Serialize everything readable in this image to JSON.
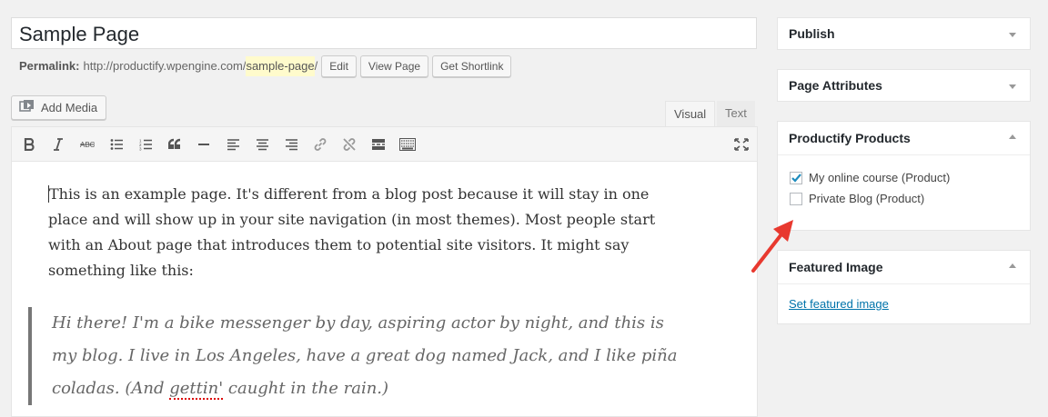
{
  "title": "Sample Page",
  "permalink": {
    "label": "Permalink:",
    "base": "http://productify.wpengine.com/",
    "slug": "sample-page",
    "trailing": "/",
    "buttons": [
      "Edit",
      "View Page",
      "Get Shortlink"
    ]
  },
  "add_media": "Add Media",
  "tabs": {
    "visual": "Visual",
    "text": "Text"
  },
  "toolbar_icons": [
    "bold-icon",
    "italic-icon",
    "strikethrough-icon",
    "bullet-list-icon",
    "numbered-list-icon",
    "blockquote-icon",
    "horizontal-line-icon",
    "align-left-icon",
    "align-center-icon",
    "align-right-icon",
    "link-icon",
    "unlink-icon",
    "read-more-icon",
    "toolbar-toggle-icon",
    "fullscreen-icon"
  ],
  "content": {
    "para1": "This is an example page. It's different from a blog post because it will stay in one place and will show up in your site navigation (in most themes). Most people start with an About page that introduces them to potential site visitors. It might say something like this:",
    "quote_part1": "Hi there! I'm a bike messenger by day, aspiring actor by night, and this is my blog. I live in Los Angeles, have a great dog named Jack, and I like piña coladas. (And ",
    "quote_misspelled": "gettin'",
    "quote_part2": " caught in the rain.)"
  },
  "sidebar": {
    "publish": "Publish",
    "page_attributes": "Page Attributes",
    "products": {
      "title": "Productify Products",
      "items": [
        {
          "label": "My online course (Product)",
          "checked": true
        },
        {
          "label": "Private Blog (Product)",
          "checked": false
        }
      ]
    },
    "featured": {
      "title": "Featured Image",
      "link": "Set featured image"
    }
  },
  "colors": {
    "accent": "#0073aa",
    "arrow": "#e8392f",
    "highlight": "#fffbcc"
  }
}
